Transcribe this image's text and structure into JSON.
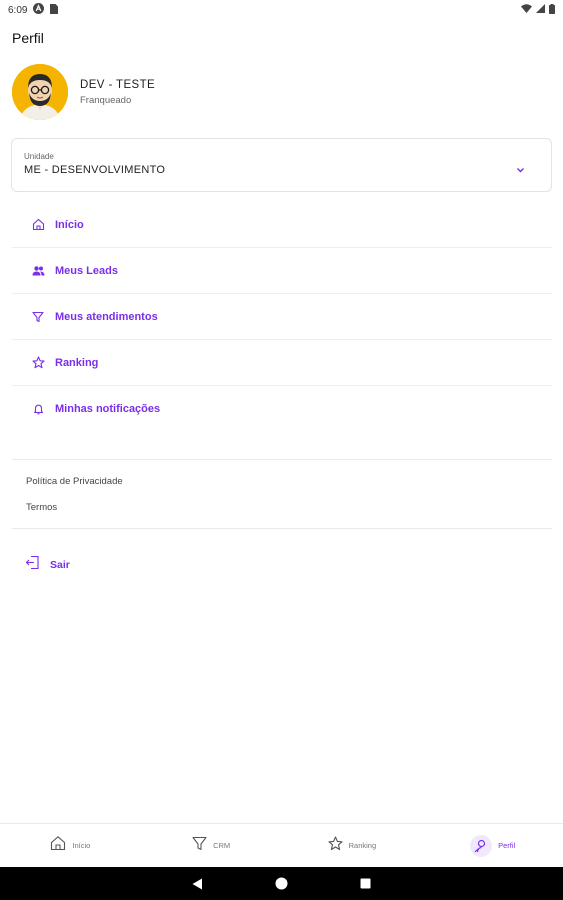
{
  "status_bar": {
    "time": "6:09",
    "icons": [
      "assistant-icon",
      "sim-icon",
      "wifi-icon",
      "signal-icon",
      "battery-icon"
    ]
  },
  "page": {
    "title": "Perfil"
  },
  "profile": {
    "name": "DEV - TESTE",
    "role": "Franqueado",
    "avatar_bg": "#f5b400"
  },
  "unit_select": {
    "label": "Unidade",
    "value": "ME - DESENVOLVIMENTO"
  },
  "menu": {
    "items": [
      {
        "label": "Início",
        "icon": "home-icon"
      },
      {
        "label": "Meus Leads",
        "icon": "people-icon"
      },
      {
        "label": "Meus atendimentos",
        "icon": "filter-icon"
      },
      {
        "label": "Ranking",
        "icon": "star-icon"
      },
      {
        "label": "Minhas notificações",
        "icon": "bell-icon"
      }
    ]
  },
  "links": {
    "privacy": "Política de Privacidade",
    "terms": "Termos"
  },
  "logout": {
    "label": "Sair"
  },
  "bottom_nav": {
    "items": [
      {
        "label": "Início",
        "icon": "home-icon",
        "active": false
      },
      {
        "label": "CRM",
        "icon": "filter-icon",
        "active": false
      },
      {
        "label": "Ranking",
        "icon": "star-icon",
        "active": false
      },
      {
        "label": "Perfil",
        "icon": "person-search-icon",
        "active": true
      }
    ]
  },
  "colors": {
    "accent": "#7b2fe8",
    "active_bg": "#f0e9fd",
    "border": "#e3e3e3"
  }
}
